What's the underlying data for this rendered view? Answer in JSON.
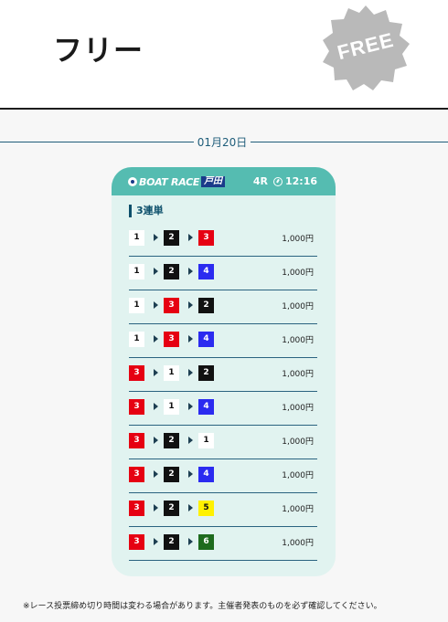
{
  "page": {
    "title": "フリー",
    "badge": "FREE"
  },
  "date": "01月20日",
  "card": {
    "logo_brand": "BOAT RACE",
    "logo_venue": "戸田",
    "race_no": "4R",
    "time": "12:16",
    "bet_type": "3連単",
    "rows": [
      {
        "combo": [
          "1",
          "2",
          "3"
        ],
        "amount": "1,000円"
      },
      {
        "combo": [
          "1",
          "2",
          "4"
        ],
        "amount": "1,000円"
      },
      {
        "combo": [
          "1",
          "3",
          "2"
        ],
        "amount": "1,000円"
      },
      {
        "combo": [
          "1",
          "3",
          "4"
        ],
        "amount": "1,000円"
      },
      {
        "combo": [
          "3",
          "1",
          "2"
        ],
        "amount": "1,000円"
      },
      {
        "combo": [
          "3",
          "1",
          "4"
        ],
        "amount": "1,000円"
      },
      {
        "combo": [
          "3",
          "2",
          "1"
        ],
        "amount": "1,000円"
      },
      {
        "combo": [
          "3",
          "2",
          "4"
        ],
        "amount": "1,000円"
      },
      {
        "combo": [
          "3",
          "2",
          "5"
        ],
        "amount": "1,000円"
      },
      {
        "combo": [
          "3",
          "2",
          "6"
        ],
        "amount": "1,000円"
      }
    ]
  },
  "boat_colors": {
    "1": {
      "bg": "#ffffff",
      "fg": "#111111"
    },
    "2": {
      "bg": "#111111",
      "fg": "#ffffff"
    },
    "3": {
      "bg": "#e60012",
      "fg": "#ffffff"
    },
    "4": {
      "bg": "#2b2bf0",
      "fg": "#ffffff"
    },
    "5": {
      "bg": "#fff100",
      "fg": "#111111"
    },
    "6": {
      "bg": "#1e6b1e",
      "fg": "#ffffff"
    }
  },
  "footer_note": "※レース投票締め切り時間は変わる場合があります。主催者発表のものを必ず確認してください。"
}
